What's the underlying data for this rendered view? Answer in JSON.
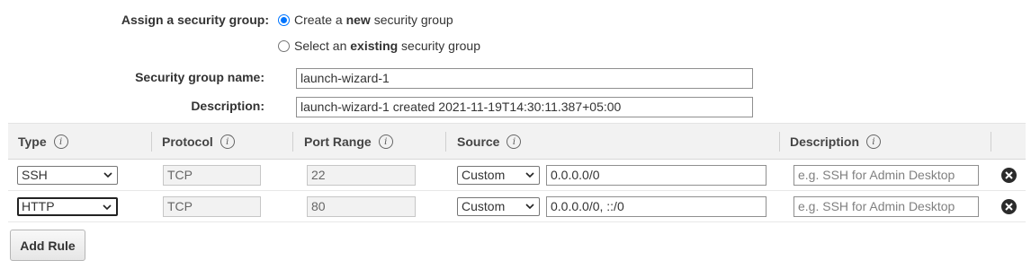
{
  "security_group": {
    "assign_label": "Assign a security group:",
    "option_create_pre": "Create a ",
    "option_create_bold": "new",
    "option_create_post": " security group",
    "option_select_pre": "Select an ",
    "option_select_bold": "existing",
    "option_select_post": " security group",
    "selected_option": "create",
    "name_label": "Security group name:",
    "name_value": "launch-wizard-1",
    "description_label": "Description:",
    "description_value": "launch-wizard-1 created 2021-11-19T14:30:11.387+05:00"
  },
  "rules_table": {
    "headers": {
      "type": "Type",
      "protocol": "Protocol",
      "port_range": "Port Range",
      "source": "Source",
      "description": "Description"
    },
    "rows": [
      {
        "type": "SSH",
        "protocol": "TCP",
        "port_range": "22",
        "source_type": "Custom",
        "source_value": "0.0.0.0/0",
        "description_placeholder": "e.g. SSH for Admin Desktop"
      },
      {
        "type": "HTTP",
        "protocol": "TCP",
        "port_range": "80",
        "source_type": "Custom",
        "source_value": "0.0.0.0/0, ::/0",
        "description_placeholder": "e.g. SSH for Admin Desktop"
      }
    ]
  },
  "buttons": {
    "add_rule": "Add Rule"
  },
  "icons": {
    "info": "info-icon",
    "remove": "remove-rule-icon",
    "dropdown": "chevron-down-icon"
  },
  "colors": {
    "radio_accent": "#0075ff",
    "header_bg": "#f2f2f2",
    "readonly_bg": "#f2f2f2"
  }
}
